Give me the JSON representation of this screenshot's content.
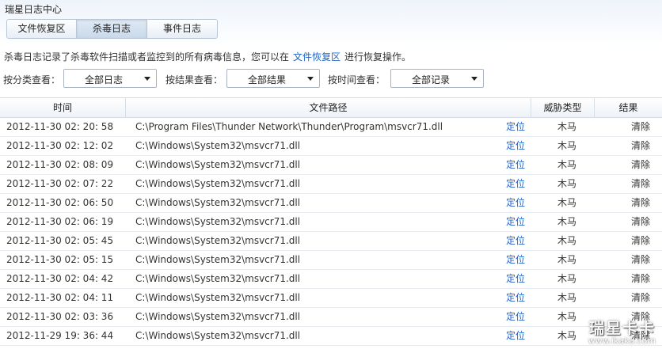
{
  "window": {
    "title": "瑞星日志中心"
  },
  "tabs": [
    {
      "label": "文件恢复区"
    },
    {
      "label": "杀毒日志",
      "active": true
    },
    {
      "label": "事件日志"
    }
  ],
  "description": {
    "prefix": "杀毒日志记录了杀毒软件扫描或者监控到的所有病毒信息，您可以在",
    "link": "文件恢复区",
    "suffix": "进行恢复操作。"
  },
  "filters": {
    "category": {
      "label": "按分类查看：",
      "value": "全部日志"
    },
    "result": {
      "label": "按结果查看：",
      "value": "全部结果"
    },
    "time": {
      "label": "按时间查看：",
      "value": "全部记录"
    }
  },
  "table": {
    "columns": [
      "时间",
      "文件路径",
      "威胁类型",
      "结果"
    ],
    "locate_label": "定位",
    "rows": [
      {
        "time": "2012-11-30 02: 20: 58",
        "path": "C:\\Program Files\\Thunder Network\\Thunder\\Program\\msvcr71.dll",
        "type": "木马",
        "result": "清除"
      },
      {
        "time": "2012-11-30 02: 12: 02",
        "path": "C:\\Windows\\System32\\msvcr71.dll",
        "type": "木马",
        "result": "清除"
      },
      {
        "time": "2012-11-30 02: 08: 09",
        "path": "C:\\Windows\\System32\\msvcr71.dll",
        "type": "木马",
        "result": "清除"
      },
      {
        "time": "2012-11-30 02: 07: 22",
        "path": "C:\\Windows\\System32\\msvcr71.dll",
        "type": "木马",
        "result": "清除"
      },
      {
        "time": "2012-11-30 02: 06: 50",
        "path": "C:\\Windows\\System32\\msvcr71.dll",
        "type": "木马",
        "result": "清除"
      },
      {
        "time": "2012-11-30 02: 06: 19",
        "path": "C:\\Windows\\System32\\msvcr71.dll",
        "type": "木马",
        "result": "清除"
      },
      {
        "time": "2012-11-30 02: 05: 45",
        "path": "C:\\Windows\\System32\\msvcr71.dll",
        "type": "木马",
        "result": "清除"
      },
      {
        "time": "2012-11-30 02: 05: 15",
        "path": "C:\\Windows\\System32\\msvcr71.dll",
        "type": "木马",
        "result": "清除"
      },
      {
        "time": "2012-11-30 02: 04: 42",
        "path": "C:\\Windows\\System32\\msvcr71.dll",
        "type": "木马",
        "result": "清除"
      },
      {
        "time": "2012-11-30 02: 04: 11",
        "path": "C:\\Windows\\System32\\msvcr71.dll",
        "type": "木马",
        "result": "清除"
      },
      {
        "time": "2012-11-30 02: 03: 36",
        "path": "C:\\Windows\\System32\\msvcr71.dll",
        "type": "木马",
        "result": "清除"
      },
      {
        "time": "2012-11-29 19: 36: 44",
        "path": "C:\\Windows\\System32\\msvcr71.dll",
        "type": "木马",
        "result": "清除"
      }
    ]
  },
  "watermark": {
    "line1": "瑞星卡卡",
    "line2": "www.ikaka.com"
  },
  "colors": {
    "link": "#1f63c6",
    "header_bg": "#eef2f7"
  }
}
